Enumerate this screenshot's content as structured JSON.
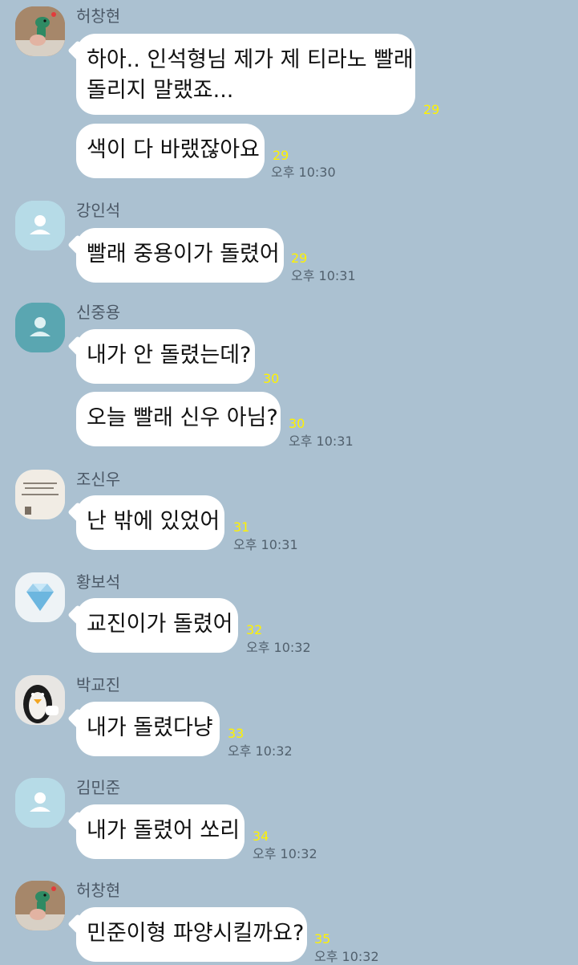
{
  "chat": {
    "messages_groups": [
      {
        "sender": "허창현",
        "avatar_icon": "dinosaur-profile-icon",
        "messages": [
          {
            "lines": [
              "하아.. 인석형님 제가 제 티라노 빨래",
              "돌리지 말랬죠..."
            ],
            "unread": "29"
          },
          {
            "lines": [
              "색이 다 바랬잖아요"
            ],
            "unread": "29",
            "time": "오후 10:30"
          }
        ]
      },
      {
        "sender": "강인석",
        "avatar_icon": "default-user-icon",
        "messages": [
          {
            "lines": [
              "빨래 중용이가 돌렸어"
            ],
            "unread": "29",
            "time": "오후 10:31"
          }
        ]
      },
      {
        "sender": "신중용",
        "avatar_icon": "default-user-dark-icon",
        "messages": [
          {
            "lines": [
              "내가 안 돌렸는데?"
            ],
            "unread": "30"
          },
          {
            "lines": [
              "오늘 빨래 신우 아님?"
            ],
            "unread": "30",
            "time": "오후 10:31"
          }
        ]
      },
      {
        "sender": "조신우",
        "avatar_icon": "text-card-profile-icon",
        "messages": [
          {
            "lines": [
              "난 밖에 있었어"
            ],
            "unread": "31",
            "time": "오후 10:31"
          }
        ]
      },
      {
        "sender": "황보석",
        "avatar_icon": "diamond-profile-icon",
        "messages": [
          {
            "lines": [
              "교진이가 돌렸어"
            ],
            "unread": "32",
            "time": "오후 10:32"
          }
        ]
      },
      {
        "sender": "박교진",
        "avatar_icon": "penguin-profile-icon",
        "messages": [
          {
            "lines": [
              "내가 돌렸다냥"
            ],
            "unread": "33",
            "time": "오후 10:32"
          }
        ]
      },
      {
        "sender": "김민준",
        "avatar_icon": "default-user-icon",
        "messages": [
          {
            "lines": [
              "내가 돌렸어 쏘리"
            ],
            "unread": "34",
            "time": "오후 10:32"
          }
        ]
      },
      {
        "sender": "허창현",
        "avatar_icon": "dinosaur-profile-icon",
        "messages": [
          {
            "lines": [
              "민준이형 파양시킬까요?"
            ],
            "unread": "35",
            "time": "오후 10:32"
          }
        ]
      }
    ]
  },
  "colors": {
    "background": "#abc1d1",
    "bubble": "#ffffff",
    "unread": "#fff200",
    "time": "#51606d",
    "sender": "#4b5866"
  }
}
